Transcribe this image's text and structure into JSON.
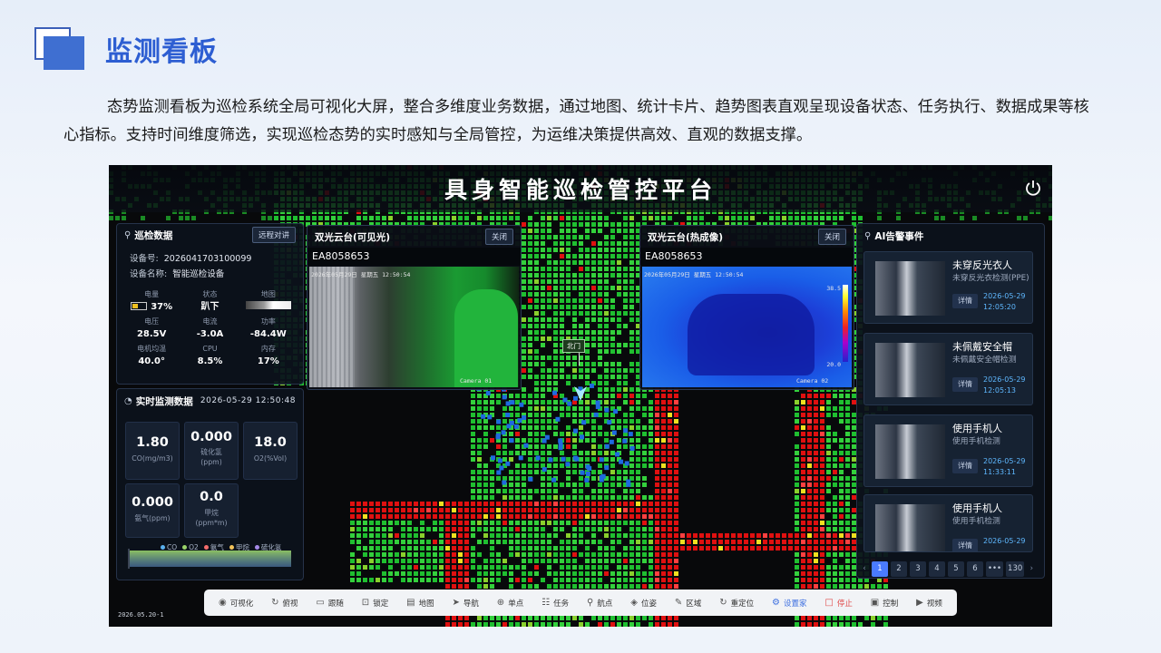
{
  "slide": {
    "title": "监测看板",
    "description": "态势监测看板为巡检系统全局可视化大屏，整合多维度业务数据，通过地图、统计卡片、趋势图表直观呈现设备状态、任务执行、数据成果等核心指标。支持时间维度筛选，实现巡检态势的实时感知与全局管控，为运维决策提供高效、直观的数据支撑。"
  },
  "app": {
    "title": "具身智能巡检管控平台",
    "footer_date": "2026.05.20-1",
    "map_marker": "北门"
  },
  "inspection": {
    "title": "巡检数据",
    "remote_button": "远程对讲",
    "device_no_label": "设备号:",
    "device_no": "2026041703100099",
    "device_name_label": "设备名称:",
    "device_name": "智能巡检设备",
    "stats": [
      {
        "label": "电量",
        "value": "37%"
      },
      {
        "label": "状态",
        "value": "趴下"
      },
      {
        "label": "地图",
        "value": ""
      },
      {
        "label": "电压",
        "value": "28.5V"
      },
      {
        "label": "电流",
        "value": "-3.0A"
      },
      {
        "label": "功率",
        "value": "-84.4W"
      },
      {
        "label": "电机均温",
        "value": "40.0°"
      },
      {
        "label": "CPU",
        "value": "8.5%"
      },
      {
        "label": "内存",
        "value": "17%"
      }
    ],
    "battery_level": 0.37
  },
  "realtime": {
    "title": "实时监测数据",
    "timestamp": "2026-05-29 12:50:48",
    "sensors": [
      {
        "value": "1.80",
        "label": "CO(mg/m3)"
      },
      {
        "value": "0.000",
        "label": "硫化氢\n(ppm)"
      },
      {
        "value": "18.0",
        "label": "O2(%Vol)"
      },
      {
        "value": "0.000",
        "label": "氨气(ppm)"
      },
      {
        "value": "0.0",
        "label": "甲烷\n(ppm*m)"
      }
    ],
    "legend": [
      {
        "name": "CO",
        "color": "#5ab1ef"
      },
      {
        "name": "O2",
        "color": "#9ad36a"
      },
      {
        "name": "氨气",
        "color": "#f36c6c"
      },
      {
        "name": "甲烷",
        "color": "#f3c35a"
      },
      {
        "name": "硫化氢",
        "color": "#a58ae8"
      }
    ]
  },
  "video_visible": {
    "title": "双光云台(可见光)",
    "close": "关闭",
    "device": "EA8058653",
    "osd_time": "2026年05月29日 星期五 12:50:54",
    "osd_cam": "Camera 01"
  },
  "video_thermal": {
    "title": "双光云台(热成像)",
    "close": "关闭",
    "device": "EA8058653",
    "osd_time": "2026年05月29日 星期五 12:50:54",
    "osd_cam": "Camera 02",
    "temp_max": "38.5",
    "temp_min": "20.0"
  },
  "alerts": {
    "title": "AI告警事件",
    "detail_label": "详情",
    "items": [
      {
        "title": "未穿反光衣人",
        "desc": "未穿反光衣检测(PPE)",
        "date": "2026-05-29",
        "time": "12:05:20"
      },
      {
        "title": "未佩戴安全帽",
        "desc": "未佩戴安全帽检测",
        "date": "2026-05-29",
        "time": "12:05:13"
      },
      {
        "title": "使用手机人",
        "desc": "使用手机检测",
        "date": "2026-05-29",
        "time": "11:33:11"
      },
      {
        "title": "使用手机人",
        "desc": "使用手机检测",
        "date": "2026-05-29",
        "time": ""
      }
    ],
    "pages": [
      "1",
      "2",
      "3",
      "4",
      "5",
      "6",
      "•••",
      "130"
    ]
  },
  "toolbar": [
    {
      "label": "可视化",
      "icon": "eye-icon",
      "glyph": "◉"
    },
    {
      "label": "俯视",
      "icon": "rotate-icon",
      "glyph": "↻"
    },
    {
      "label": "跟随",
      "icon": "camera-icon",
      "glyph": "▭"
    },
    {
      "label": "锁定",
      "icon": "lock-icon",
      "glyph": "⊡"
    },
    {
      "label": "地图",
      "icon": "map-icon",
      "glyph": "▤"
    },
    {
      "label": "导航",
      "icon": "navigation-icon",
      "glyph": "➤"
    },
    {
      "label": "单点",
      "icon": "target-icon",
      "glyph": "⊕"
    },
    {
      "label": "任务",
      "icon": "task-icon",
      "glyph": "☷"
    },
    {
      "label": "航点",
      "icon": "waypoint-icon",
      "glyph": "⚲"
    },
    {
      "label": "位姿",
      "icon": "pose-icon",
      "glyph": "◈"
    },
    {
      "label": "区域",
      "icon": "pencil-icon",
      "glyph": "✎"
    },
    {
      "label": "重定位",
      "icon": "relocate-icon",
      "glyph": "↻"
    },
    {
      "label": "设置家",
      "icon": "gear-icon",
      "glyph": "⚙",
      "accent": "blue"
    },
    {
      "label": "停止",
      "icon": "stop-icon",
      "glyph": "□",
      "accent": "red"
    },
    {
      "label": "控制",
      "icon": "gamepad-icon",
      "glyph": "▣"
    },
    {
      "label": "视频",
      "icon": "video-icon",
      "glyph": "▶"
    }
  ]
}
